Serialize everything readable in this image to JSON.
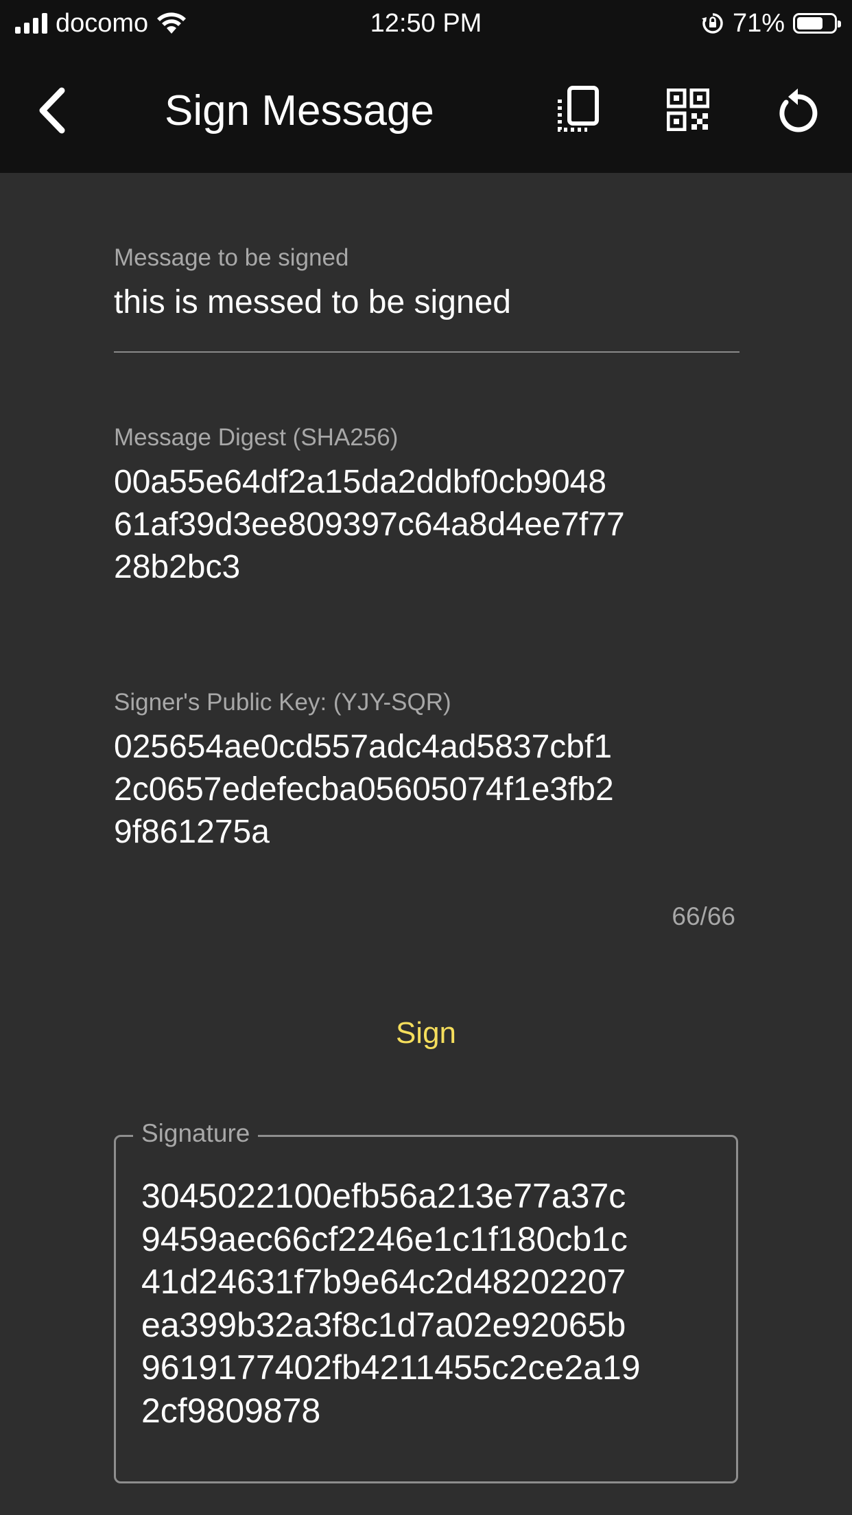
{
  "status_bar": {
    "carrier": "docomo",
    "time": "12:50 PM",
    "battery_percent": "71%",
    "battery_level": 0.71
  },
  "app_bar": {
    "title": "Sign Message",
    "back_icon": "chevron-left-icon",
    "actions": [
      "copy-icon",
      "qr-code-icon",
      "refresh-icon"
    ]
  },
  "form": {
    "message_label": "Message to be signed",
    "message_value": "this is messed to be signed",
    "digest_label": "Message Digest (SHA256)",
    "digest_line1": "00a55e64df2a15da2ddbf0cb9048",
    "digest_line2": "61af39d3ee809397c64a8d4ee7f77",
    "digest_line3": "28b2bc3",
    "pubkey_label": "Signer's Public Key: (YJY-SQR)",
    "pubkey_line1": "025654ae0cd557adc4ad5837cbf1",
    "pubkey_line2": "2c0657edefecba05605074f1e3fb2",
    "pubkey_line3": "9f861275a",
    "pubkey_counter": "66/66",
    "sign_button": "Sign",
    "signature_label": "Signature",
    "signature_line1": "3045022100efb56a213e77a37c",
    "signature_line2": "9459aec66cf2246e1c1f180cb1c",
    "signature_line3": "41d24631f7b9e64c2d48202207",
    "signature_line4": "ea399b32a3f8c1d7a02e92065b",
    "signature_line5": "9619177402fb4211455c2ce2a19",
    "signature_line6": "2cf9809878"
  },
  "colors": {
    "bar_background": "#111111",
    "page_background": "#2e2e2e",
    "accent": "#f5de5c"
  }
}
